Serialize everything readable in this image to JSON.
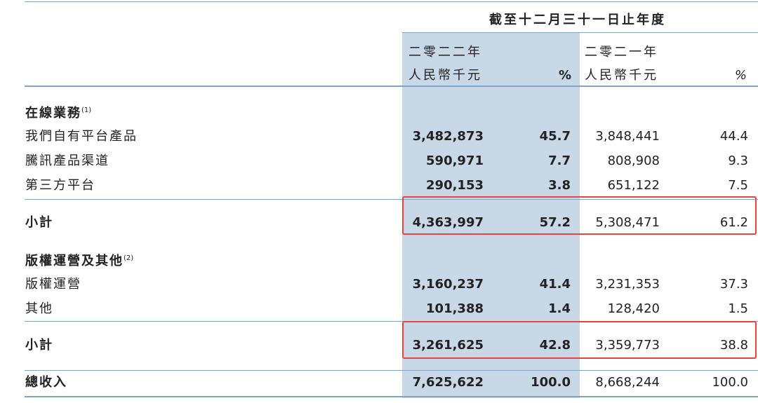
{
  "header": {
    "period": "截至十二月三十一日止年度",
    "year_2022": "二零二二年",
    "year_2021": "二零二一年",
    "unit_2022": "人民幣千元",
    "unit_2021": "人民幣千元",
    "pct_2022": "%",
    "pct_2021": "%"
  },
  "sections": {
    "online": {
      "title": "在線業務",
      "note": "(1)"
    },
    "copyright": {
      "title": "版權運營及其他",
      "note": "(2)"
    }
  },
  "rows": {
    "own_platform": {
      "label": "我們自有平台產品",
      "v2022": "3,482,873",
      "p2022": "45.7",
      "v2021": "3,848,441",
      "p2021": "44.4"
    },
    "tencent": {
      "label": "騰訊產品渠道",
      "v2022": "590,971",
      "p2022": "7.7",
      "v2021": "808,908",
      "p2021": "9.3"
    },
    "third_party": {
      "label": "第三方平台",
      "v2022": "290,153",
      "p2022": "3.8",
      "v2021": "651,122",
      "p2021": "7.5"
    },
    "subtotal_online": {
      "label": "小計",
      "v2022": "4,363,997",
      "p2022": "57.2",
      "v2021": "5,308,471",
      "p2021": "61.2"
    },
    "copyright_ops": {
      "label": "版權運營",
      "v2022": "3,160,237",
      "p2022": "41.4",
      "v2021": "3,231,353",
      "p2021": "37.3"
    },
    "others": {
      "label": "其他",
      "v2022": "101,388",
      "p2022": "1.4",
      "v2021": "128,420",
      "p2021": "1.5"
    },
    "subtotal_copyright": {
      "label": "小計",
      "v2022": "3,261,625",
      "p2022": "42.8",
      "v2021": "3,359,773",
      "p2021": "38.8"
    },
    "total": {
      "label": "總收入",
      "v2022": "7,625,622",
      "p2022": "100.0",
      "v2021": "8,668,244",
      "p2021": "100.0"
    }
  },
  "colors": {
    "highlight_column": "#c9d8e6",
    "rule": "#7fa4c4",
    "annotation_box": "#e2463d"
  }
}
